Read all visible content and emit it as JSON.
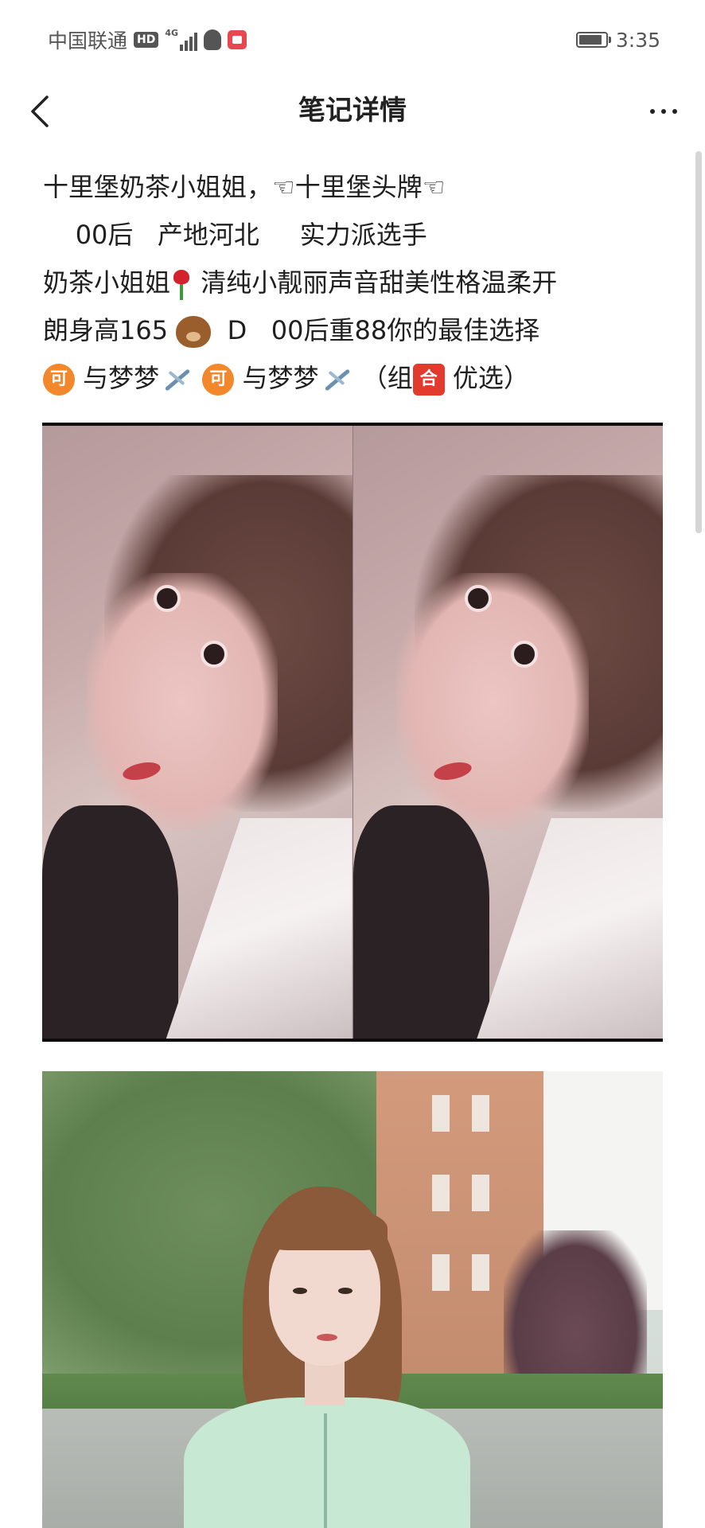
{
  "status_bar": {
    "carrier": "中国联通",
    "hd_badge": "HD",
    "network_label": "4G",
    "time": "3:35",
    "icons": [
      "hd-icon",
      "signal-icon",
      "qq-icon",
      "app-notification-icon",
      "battery-icon"
    ]
  },
  "nav": {
    "back_icon": "chevron-left-icon",
    "title": "笔记详情",
    "more_icon": "more-horizontal-icon"
  },
  "note": {
    "line1": "十里堡奶茶小姐姐，☜十里堡头牌☜",
    "line2": "    00后   产地河北     实力派选手",
    "line3a": "奶茶小姐姐",
    "line3b": " 清纯小靓丽声音甜美性格温柔开",
    "line4a": "朗身高165 ",
    "line4b": "  D   00后重88你的最佳选择",
    "line5a": " 与梦梦",
    "line5b": " ",
    "line5c": " 与梦梦",
    "line5d": " （组",
    "line5e": " 优选）",
    "emoji_ke": "可",
    "emoji_he": "合",
    "emoji_names": [
      "rose-emoji",
      "bear-emoji",
      "ke-emoji",
      "airplane-emoji",
      "he-emoji"
    ]
  },
  "images": [
    {
      "name": "selfie-collage",
      "panels": 2
    },
    {
      "name": "outdoor-portrait"
    }
  ],
  "colors": {
    "text": "#1f1f1f",
    "status": "#555555",
    "ke_badge": "#f2872b",
    "he_badge": "#e23b2e"
  }
}
